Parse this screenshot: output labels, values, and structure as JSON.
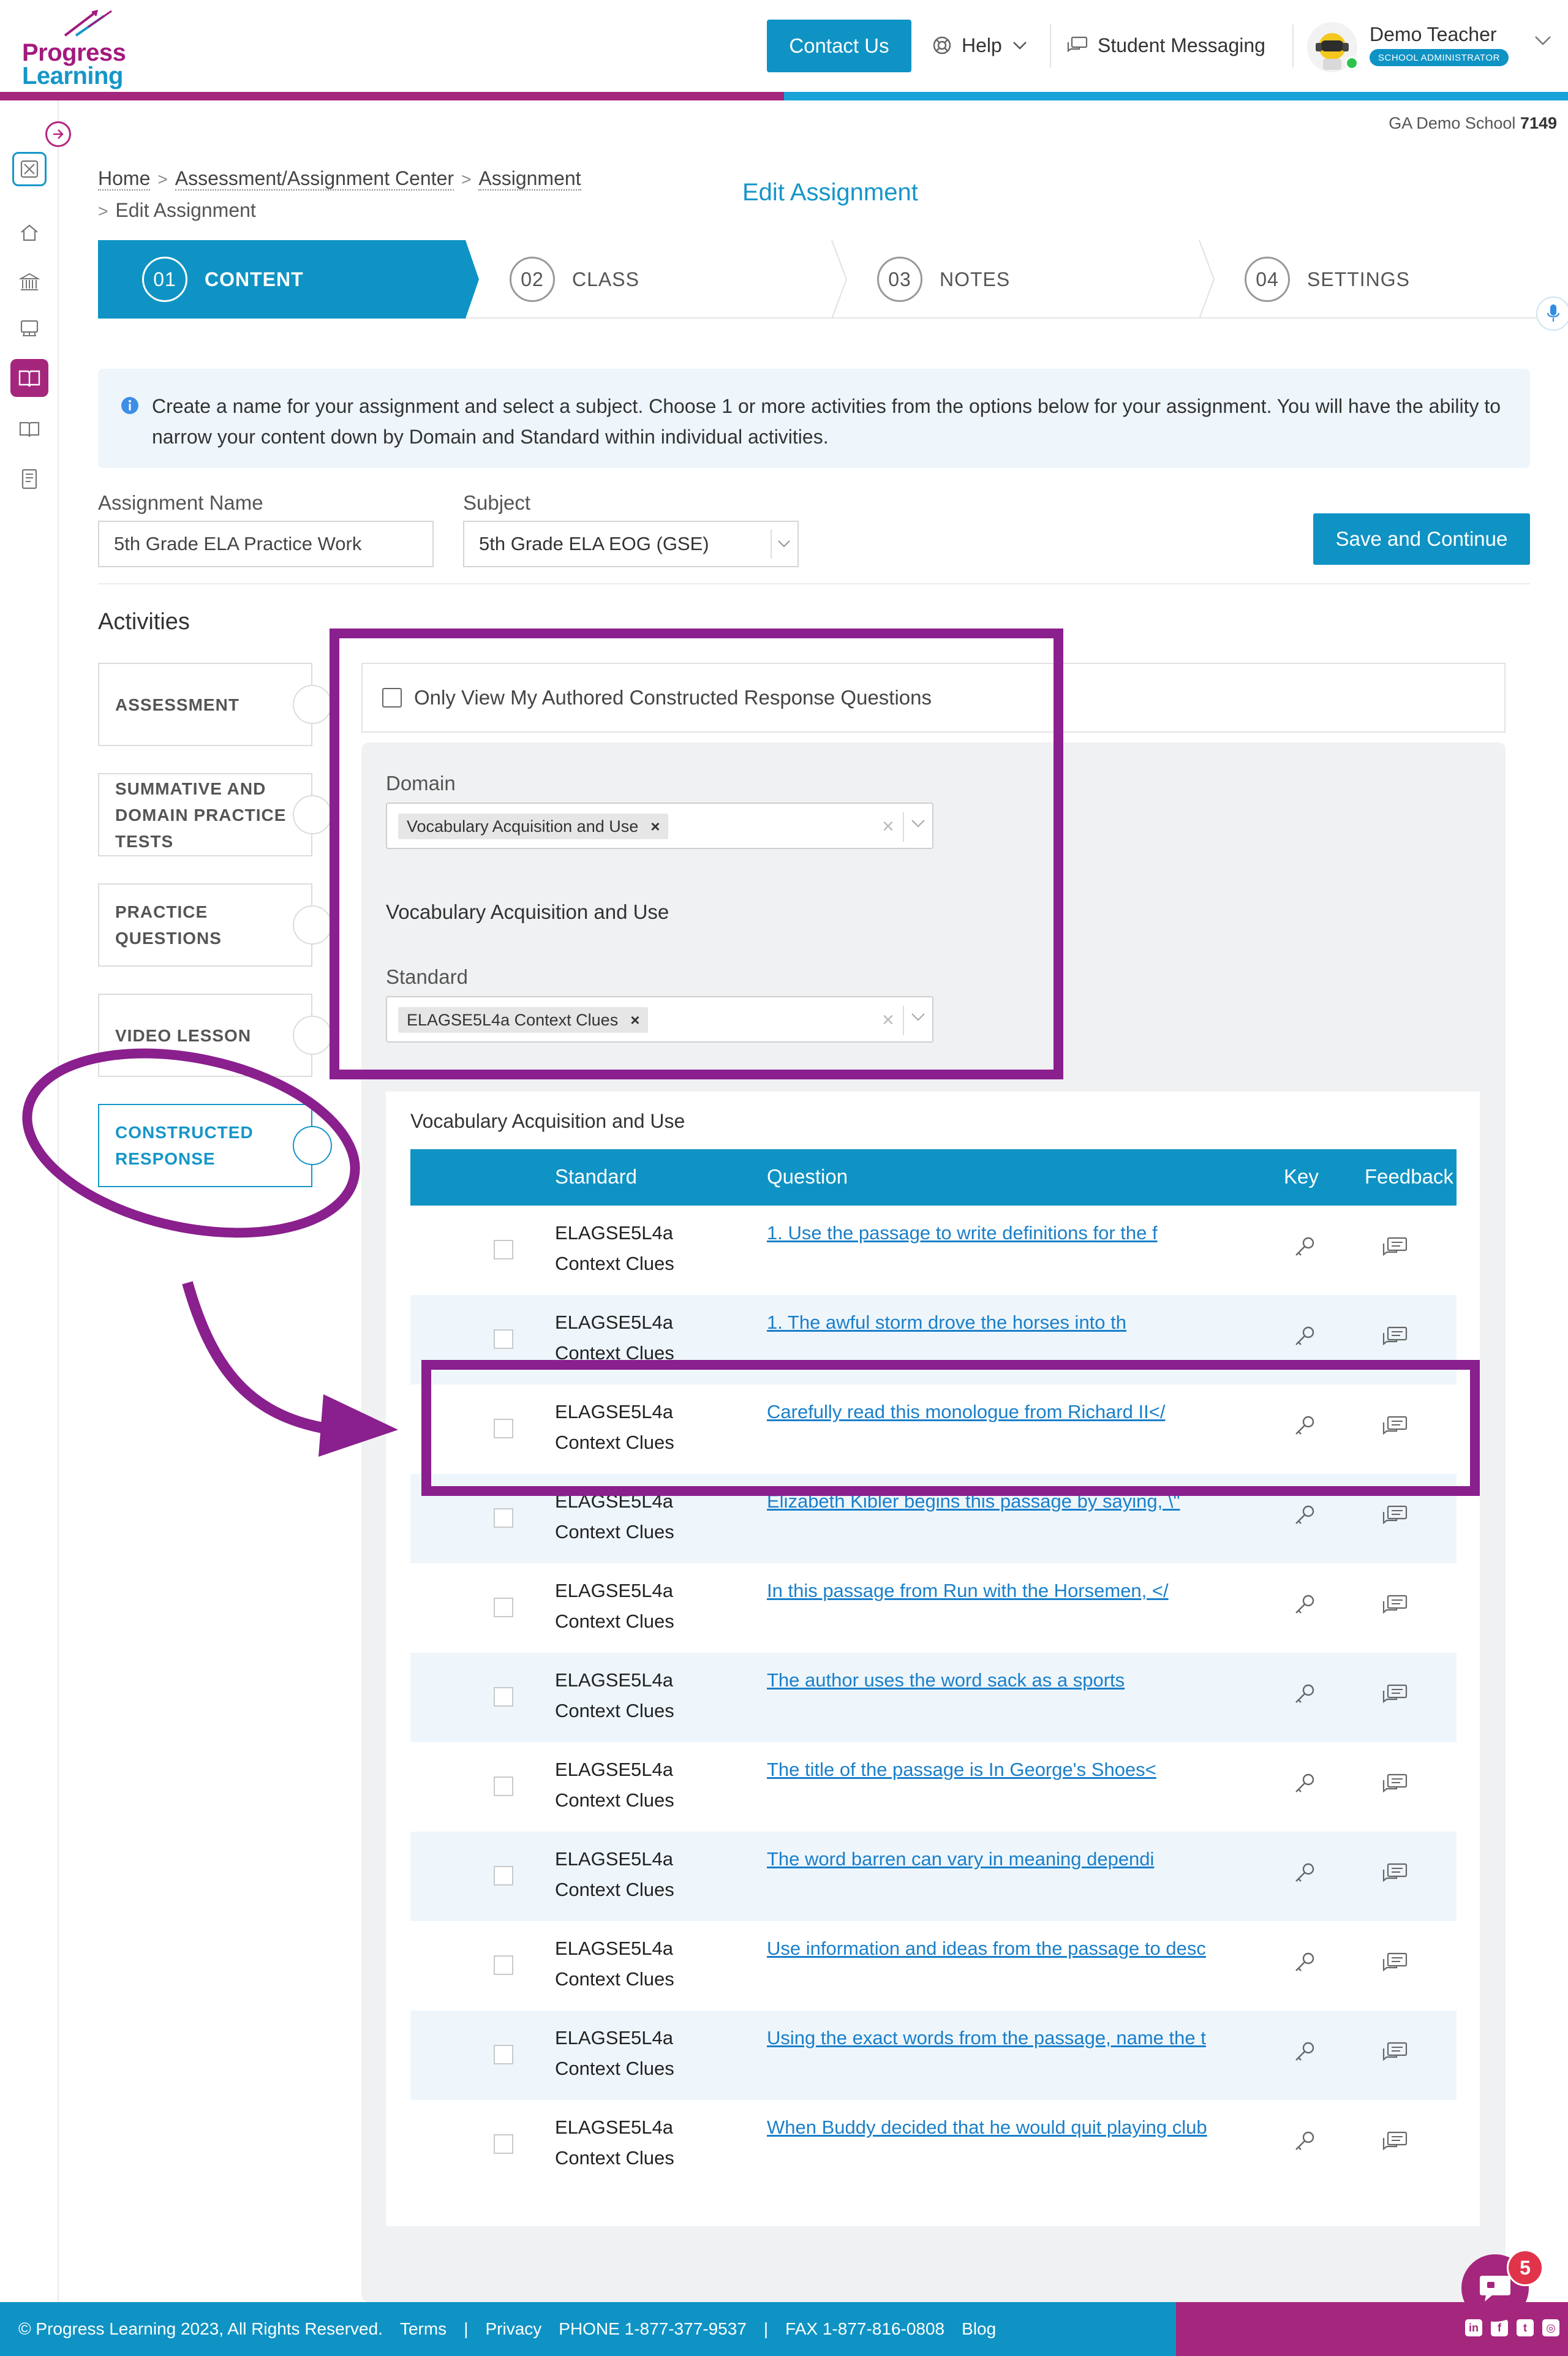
{
  "logo": {
    "line1": "Progress",
    "line2": "Learning"
  },
  "header": {
    "contact_label": "Contact Us",
    "help_label": "Help",
    "messaging_label": "Student Messaging",
    "user_name": "Demo Teacher",
    "user_role": "SCHOOL ADMINISTRATOR"
  },
  "school": {
    "name": "GA Demo School",
    "id": "7149"
  },
  "breadcrumb": {
    "home": "Home",
    "center": "Assessment/Assignment Center",
    "assignment": "Assignment",
    "current": "Edit Assignment"
  },
  "page_title": "Edit Assignment",
  "steps": [
    {
      "num": "01",
      "label": "CONTENT"
    },
    {
      "num": "02",
      "label": "CLASS"
    },
    {
      "num": "03",
      "label": "NOTES"
    },
    {
      "num": "04",
      "label": "SETTINGS"
    }
  ],
  "info_text": "Create a name for your assignment and select a subject. Choose 1 or more activities from the options below for your assignment. You will have the ability to narrow your content down by Domain and Standard within individual activities.",
  "form": {
    "name_label": "Assignment Name",
    "name_value": "5th Grade ELA Practice Work",
    "subject_label": "Subject",
    "subject_value": "5th Grade ELA EOG (GSE)",
    "save_label": "Save and Continue"
  },
  "activities": {
    "title": "Activities",
    "tabs": [
      "ASSESSMENT",
      "SUMMATIVE AND DOMAIN PRACTICE TESTS",
      "PRACTICE QUESTIONS",
      "VIDEO LESSON",
      "CONSTRUCTED RESPONSE"
    ]
  },
  "filters": {
    "only_mine_label": "Only View My Authored Constructed Response Questions",
    "domain_label": "Domain",
    "domain_chip": "Vocabulary Acquisition and Use",
    "domain_heading": "Vocabulary Acquisition and Use",
    "standard_label": "Standard",
    "standard_chip": "ELAGSE5L4a Context Clues"
  },
  "table": {
    "title": "Vocabulary Acquisition and Use",
    "headers": {
      "standard": "Standard",
      "question": "Question",
      "key": "Key",
      "feedback": "Feedback"
    },
    "rows": [
      {
        "code": "ELAGSE5L4a",
        "name": "Context Clues",
        "question": "1. Use the passage to write definitions for the f"
      },
      {
        "code": "ELAGSE5L4a",
        "name": "Context Clues",
        "question": "1. The awful storm drove the horses into th"
      },
      {
        "code": "ELAGSE5L4a",
        "name": "Context Clues",
        "question": "Carefully read this monologue from Richard II</"
      },
      {
        "code": "ELAGSE5L4a",
        "name": "Context Clues",
        "question": "Elizabeth Kibler begins this passage by saying, \\\""
      },
      {
        "code": "ELAGSE5L4a",
        "name": "Context Clues",
        "question": "In this passage from Run with the Horsemen, </"
      },
      {
        "code": "ELAGSE5L4a",
        "name": "Context Clues",
        "question": "The author uses the word sack as a sports"
      },
      {
        "code": "ELAGSE5L4a",
        "name": "Context Clues",
        "question": "The title of the passage is In George's Shoes<"
      },
      {
        "code": "ELAGSE5L4a",
        "name": "Context Clues",
        "question": "The word barren can vary in meaning dependi"
      },
      {
        "code": "ELAGSE5L4a",
        "name": "Context Clues",
        "question": "Use information and ideas from the passage to desc"
      },
      {
        "code": "ELAGSE5L4a",
        "name": "Context Clues",
        "question": "Using the exact words from the passage, name the t"
      },
      {
        "code": "ELAGSE5L4a",
        "name": "Context Clues",
        "question": "When Buddy decided that he would quit playing club"
      }
    ]
  },
  "footer": {
    "copyright": "© Progress Learning 2023, All Rights Reserved.",
    "terms": "Terms",
    "privacy": "Privacy",
    "phone": "PHONE 1-877-377-9537",
    "fax": "FAX 1-877-816-0808",
    "blog": "Blog"
  },
  "chat_badge": "5",
  "colors": {
    "brand_blue": "#0f93c4",
    "brand_purple": "#a5267d",
    "annotation_purple": "#8a1f8e",
    "link_blue": "#1a7fc9"
  }
}
